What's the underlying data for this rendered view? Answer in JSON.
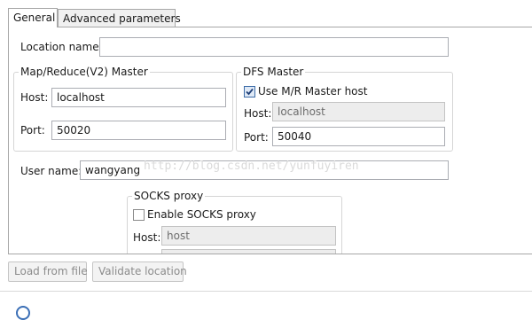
{
  "tabs": [
    {
      "label": "General",
      "active": true
    },
    {
      "label": "Advanced parameters",
      "active": false
    }
  ],
  "general": {
    "location_name": {
      "label": "Location name:",
      "value": ""
    },
    "mapreduce_master": {
      "title": "Map/Reduce(V2) Master",
      "host": {
        "label": "Host:",
        "value": "localhost"
      },
      "port": {
        "label": "Port:",
        "value": "50020"
      }
    },
    "dfs_master": {
      "title": "DFS Master",
      "use_mr_host": {
        "label": "Use M/R Master host",
        "checked": true
      },
      "host": {
        "label": "Host:",
        "value": "localhost",
        "disabled": true
      },
      "port": {
        "label": "Port:",
        "value": "50040"
      }
    },
    "user_name": {
      "label": "User name:",
      "value": "wangyang"
    },
    "socks_proxy": {
      "title": "SOCKS proxy",
      "enable": {
        "label": "Enable SOCKS proxy",
        "checked": false
      },
      "host": {
        "label": "Host:",
        "value": "host",
        "disabled": true
      }
    }
  },
  "watermark": "http://blog.csdn.net/yunfuyiren",
  "buttons": {
    "load_from_file": "Load from file",
    "validate_location": "Validate location"
  },
  "colors": {
    "border": "#a7a7a7",
    "disabled_field": "#ededed",
    "check_accent": "#3d6ca7"
  }
}
